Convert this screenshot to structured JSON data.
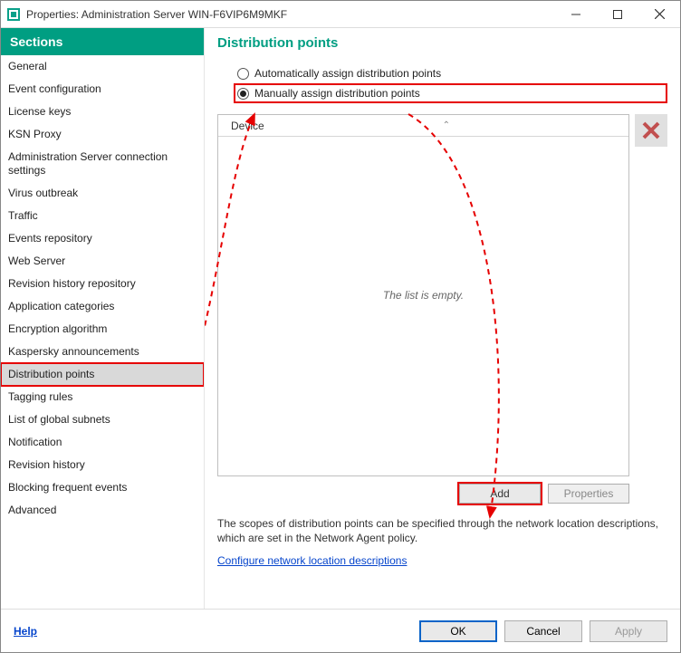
{
  "window": {
    "title": "Properties: Administration Server WIN-F6VIP6M9MKF"
  },
  "sidebar": {
    "header": "Sections",
    "items": [
      "General",
      "Event configuration",
      "License keys",
      "KSN Proxy",
      "Administration Server connection settings",
      "Virus outbreak",
      "Traffic",
      "Events repository",
      "Web Server",
      "Revision history repository",
      "Application categories",
      "Encryption algorithm",
      "Kaspersky announcements",
      "Distribution points",
      "Tagging rules",
      "List of global subnets",
      "Notification",
      "Revision history",
      "Blocking frequent events",
      "Advanced"
    ],
    "selected_index": 13
  },
  "content": {
    "title": "Distribution points",
    "radio_auto": "Automatically assign distribution points",
    "radio_manual": "Manually assign distribution points",
    "selected_radio": "manual",
    "list_column": "Device",
    "empty_text": "The list is empty.",
    "add_btn": "Add",
    "props_btn": "Properties",
    "hint": "The scopes of distribution points can be specified through the network location descriptions, which are set in the Network Agent policy.",
    "link": "Configure network location descriptions"
  },
  "footer": {
    "help": "Help",
    "ok": "OK",
    "cancel": "Cancel",
    "apply": "Apply"
  }
}
